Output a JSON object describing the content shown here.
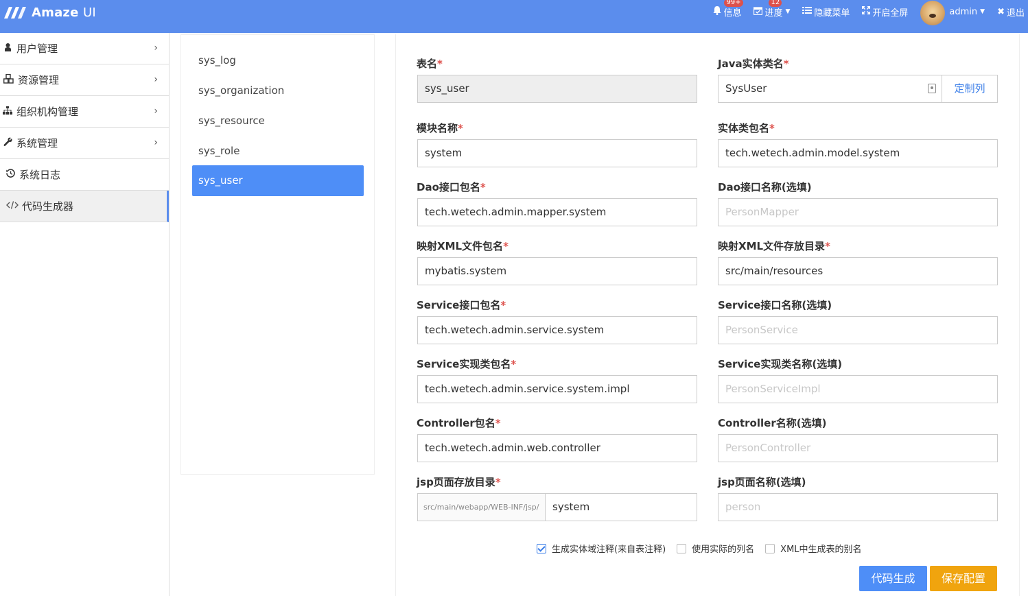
{
  "header": {
    "logo_text_bold": "Amaze",
    "logo_text_light": "UI",
    "nav": [
      {
        "label": "信息",
        "icon": "bell-icon",
        "badge": "99+"
      },
      {
        "label": "进度",
        "icon": "calendar-icon",
        "badge": "12"
      },
      {
        "label": "隐藏菜单",
        "icon": "list-icon"
      },
      {
        "label": "开启全屏",
        "icon": "fullscreen-icon"
      }
    ],
    "user": "admin",
    "logout": "退出"
  },
  "sidebar": {
    "items": [
      {
        "label": "用户管理",
        "icon": "user-icon",
        "has_arrow": true
      },
      {
        "label": "资源管理",
        "icon": "cubes-icon",
        "has_arrow": true
      },
      {
        "label": "组织机构管理",
        "icon": "sitemap-icon",
        "has_arrow": true
      },
      {
        "label": "系统管理",
        "icon": "wrench-icon",
        "has_arrow": true
      },
      {
        "label": "系统日志",
        "icon": "history-icon",
        "has_arrow": false
      },
      {
        "label": "代码生成器",
        "icon": "code-icon",
        "has_arrow": false,
        "active": true
      }
    ]
  },
  "tables": {
    "items": [
      "sys_log",
      "sys_organization",
      "sys_resource",
      "sys_role",
      "sys_user"
    ],
    "selected": "sys_user"
  },
  "form": {
    "table_name": {
      "label": "表名",
      "value": "sys_user"
    },
    "entity_class": {
      "label": "Java实体类名",
      "value": "SysUser",
      "button": "定制列"
    },
    "module_name": {
      "label": "模块名称",
      "value": "system"
    },
    "entity_package": {
      "label": "实体类包名",
      "value": "tech.wetech.admin.model.system"
    },
    "dao_package": {
      "label": "Dao接口包名",
      "value": "tech.wetech.admin.mapper.system"
    },
    "dao_name": {
      "label": "Dao接口名称(选填)",
      "placeholder": "PersonMapper"
    },
    "xml_package": {
      "label": "映射XML文件包名",
      "value": "mybatis.system"
    },
    "xml_dir": {
      "label": "映射XML文件存放目录",
      "value": "src/main/resources"
    },
    "service_package": {
      "label": "Service接口包名",
      "value": "tech.wetech.admin.service.system"
    },
    "service_name": {
      "label": "Service接口名称(选填)",
      "placeholder": "PersonService"
    },
    "service_impl_package": {
      "label": "Service实现类包名",
      "value": "tech.wetech.admin.service.system.impl"
    },
    "service_impl_name": {
      "label": "Service实现类名称(选填)",
      "placeholder": "PersonServiceImpl"
    },
    "controller_package": {
      "label": "Controller包名",
      "value": "tech.wetech.admin.web.controller"
    },
    "controller_name": {
      "label": "Controller名称(选填)",
      "placeholder": "PersonController"
    },
    "jsp_dir": {
      "label": "jsp页面存放目录",
      "prefix": "src/main/webapp/WEB-INF/jsp/",
      "value": "system"
    },
    "jsp_name": {
      "label": "jsp页面名称(选填)",
      "placeholder": "person"
    },
    "checkboxes": [
      {
        "label": "生成实体域注释(来自表注释)",
        "checked": true
      },
      {
        "label": "使用实际的列名",
        "checked": false
      },
      {
        "label": "XML中生成表的别名",
        "checked": false
      }
    ],
    "generate_button": "代码生成",
    "save_button": "保存配置",
    "required_mark": "*"
  },
  "colors": {
    "header": "#5b8ded",
    "primary": "#4e8ef7",
    "warning": "#f0a40e",
    "required": "#dd514c"
  }
}
